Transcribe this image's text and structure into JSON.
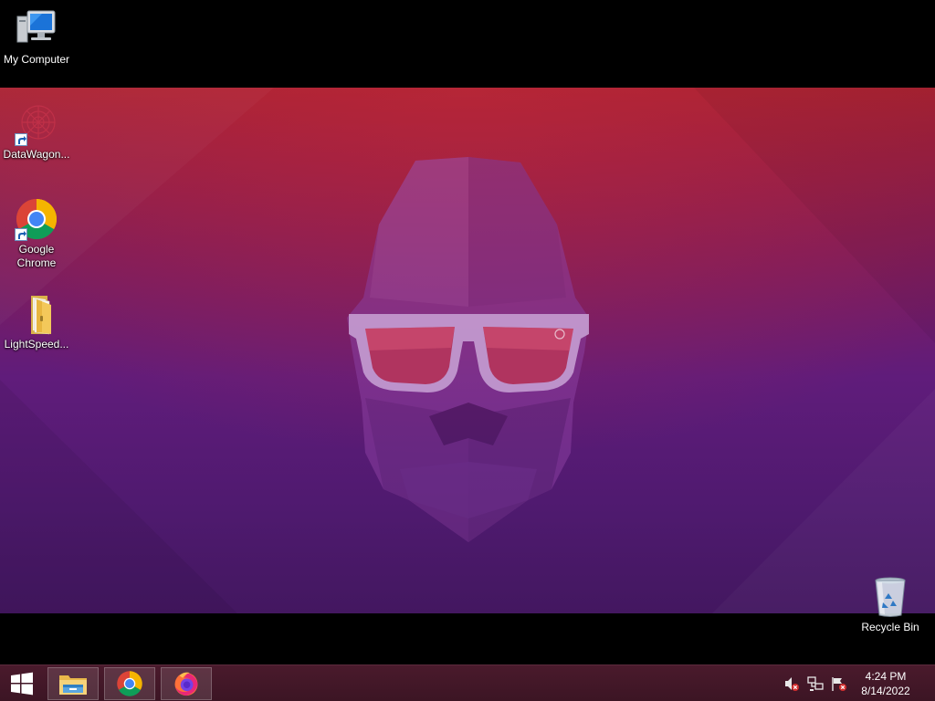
{
  "desktop": {
    "icons": [
      {
        "label": "My Computer",
        "icon": "computer-icon"
      },
      {
        "label": "DataWagon...",
        "icon": "datawagon-icon"
      },
      {
        "label": "Google Chrome",
        "icon": "chrome-icon"
      },
      {
        "label": "LightSpeed...",
        "icon": "folder-icon"
      },
      {
        "label": "Recycle Bin",
        "icon": "recycle-bin-icon"
      }
    ],
    "wallpaper": {
      "theme": "gorilla-with-sunglasses",
      "colors": {
        "top": "#a72231",
        "bottom": "#431760"
      }
    }
  },
  "taskbar": {
    "start_icon": "windows-logo-icon",
    "pinned": [
      {
        "app": "File Explorer",
        "icon": "file-explorer-icon"
      },
      {
        "app": "Google Chrome",
        "icon": "chrome-icon"
      },
      {
        "app": "Firefox",
        "icon": "firefox-icon"
      }
    ],
    "tray": {
      "icons": [
        "volume-muted-icon",
        "network-icon",
        "action-center-flag-icon"
      ]
    },
    "clock": {
      "time": "4:24 PM",
      "date": "8/14/2022"
    }
  }
}
